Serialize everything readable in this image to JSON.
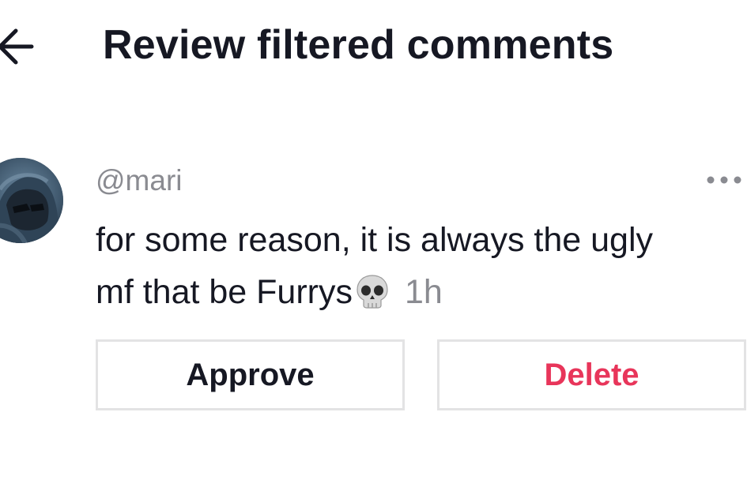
{
  "header": {
    "title": "Review filtered comments",
    "back_icon": "arrow-left-icon"
  },
  "comment": {
    "avatar": "user-avatar",
    "username": "@mari",
    "text_line1": "for some reason, it is always the ugly",
    "text_line2": "mf that be Furrys",
    "emoji": "skull-icon",
    "time": "1h",
    "more_icon": "more-options-icon"
  },
  "actions": {
    "approve_label": "Approve",
    "delete_label": "Delete"
  },
  "colors": {
    "text_primary": "#161823",
    "text_secondary": "#8a8b91",
    "delete": "#e8355a",
    "button_border": "#e3e3e4"
  }
}
